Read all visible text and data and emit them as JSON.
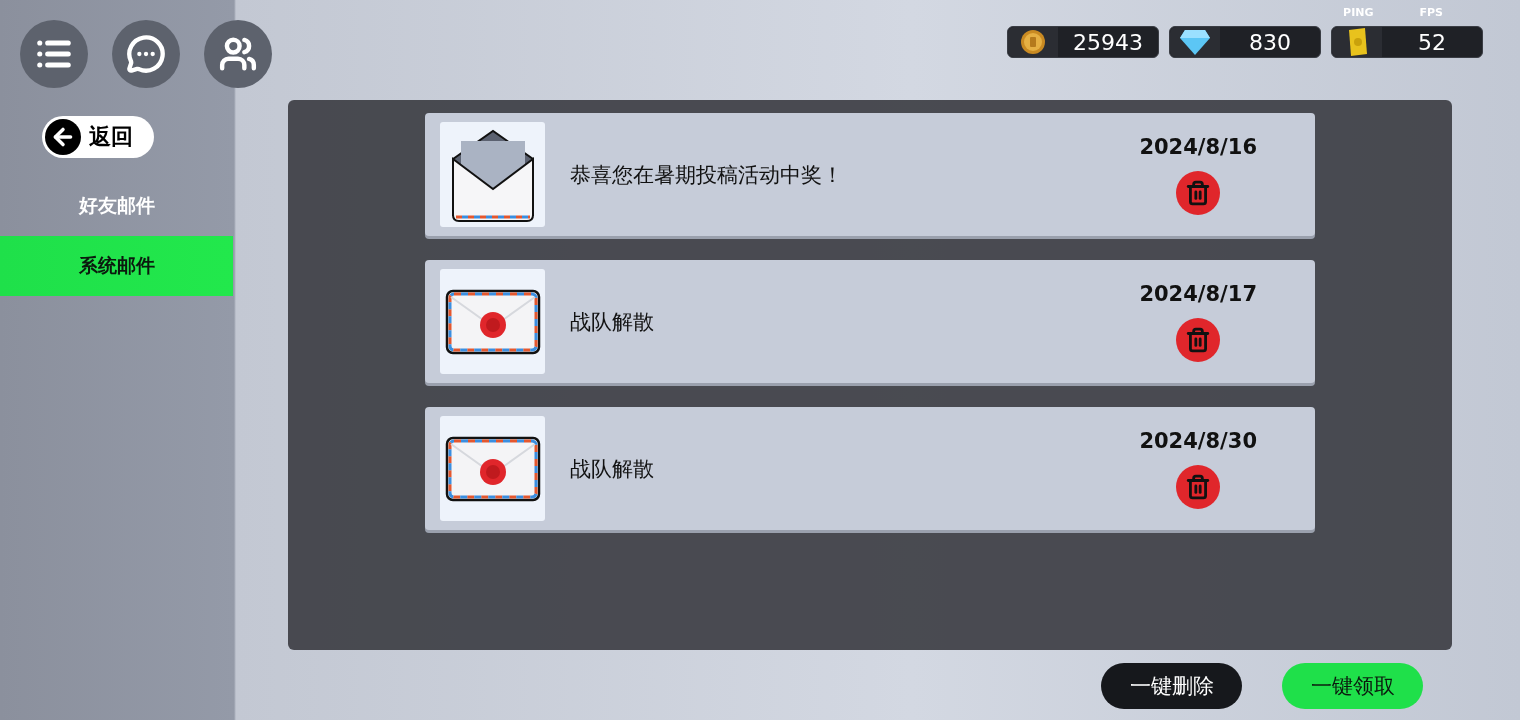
{
  "stats": {
    "ping_label": "PING",
    "fps_label": "FPS"
  },
  "currencies": [
    {
      "kind": "coin",
      "amount": "25943"
    },
    {
      "kind": "diamond",
      "amount": "830"
    },
    {
      "kind": "ticket",
      "amount": "52"
    }
  ],
  "back_button": "返回",
  "tabs": [
    {
      "label": "好友邮件",
      "selected": false
    },
    {
      "label": "系统邮件",
      "selected": true
    }
  ],
  "mails": [
    {
      "subject": "恭喜您在暑期投稿活动中奖！",
      "date": "2024/8/16",
      "opened": true
    },
    {
      "subject": "战队解散",
      "date": "2024/8/17",
      "opened": false
    },
    {
      "subject": "战队解散",
      "date": "2024/8/30",
      "opened": false
    }
  ],
  "actions": [
    {
      "label": "一键删除",
      "kind": "delete"
    },
    {
      "label": "一键领取",
      "kind": "claim"
    }
  ]
}
